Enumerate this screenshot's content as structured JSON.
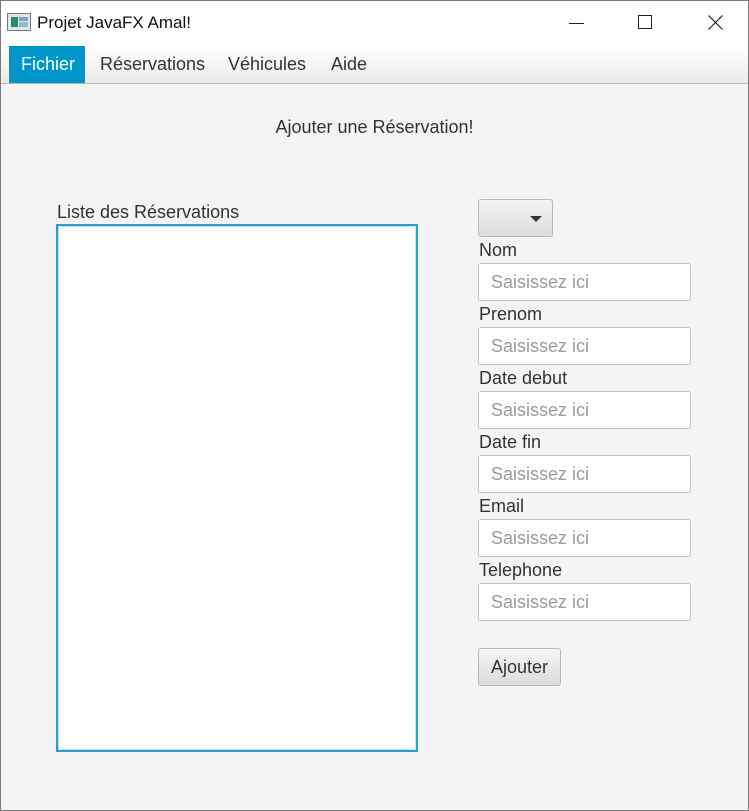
{
  "window": {
    "title": "Projet JavaFX Amal!"
  },
  "menu": {
    "items": [
      {
        "label": "Fichier",
        "active": true
      },
      {
        "label": "Réservations",
        "active": false
      },
      {
        "label": "Véhicules",
        "active": false
      },
      {
        "label": "Aide",
        "active": false
      }
    ]
  },
  "main": {
    "heading": "Ajouter une Réservation!",
    "list_label": "Liste des Réservations",
    "list_items": [],
    "combo_value": "",
    "fields": [
      {
        "label": "Nom",
        "placeholder": "Saisissez ici",
        "value": ""
      },
      {
        "label": "Prenom",
        "placeholder": "Saisissez ici",
        "value": ""
      },
      {
        "label": "Date debut",
        "placeholder": "Saisissez ici",
        "value": ""
      },
      {
        "label": "Date fin",
        "placeholder": "Saisissez ici",
        "value": ""
      },
      {
        "label": "Email",
        "placeholder": "Saisissez ici",
        "value": ""
      },
      {
        "label": "Telephone",
        "placeholder": "Saisissez ici",
        "value": ""
      }
    ],
    "add_button_label": "Ajouter"
  },
  "colors": {
    "accent": "#0096c9",
    "list_border": "#2ba0c9",
    "background": "#f4f4f4"
  }
}
